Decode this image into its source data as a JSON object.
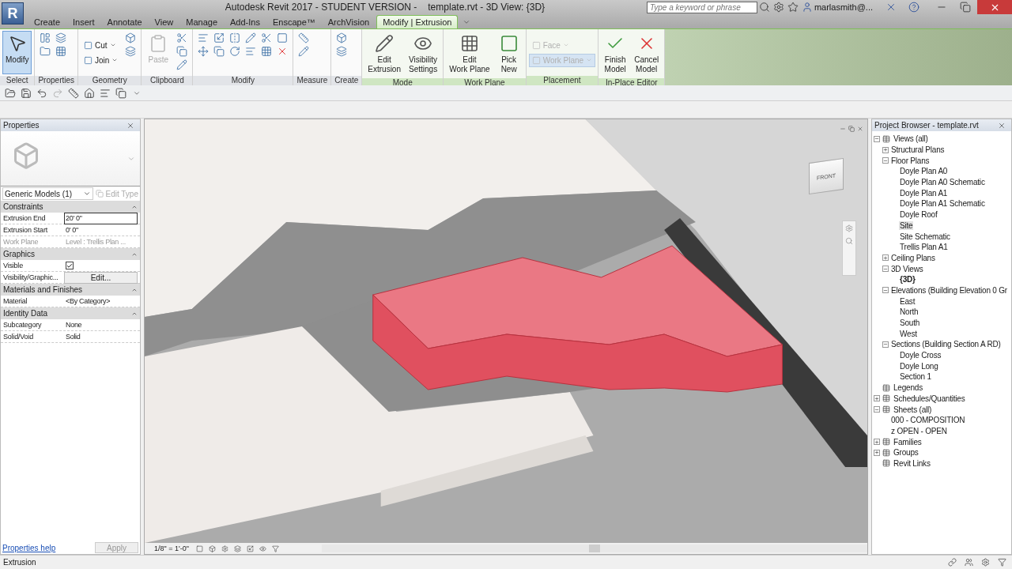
{
  "app_button": "R",
  "window": {
    "app_title": "Autodesk Revit 2017 - STUDENT VERSION -",
    "doc_title": "template.rvt - 3D View: {3D}"
  },
  "search": {
    "placeholder": "Type a keyword or phrase"
  },
  "user": "marlasmith@...",
  "tabs": [
    {
      "label": "Create",
      "selected": false
    },
    {
      "label": "Insert",
      "selected": false
    },
    {
      "label": "Annotate",
      "selected": false
    },
    {
      "label": "View",
      "selected": false
    },
    {
      "label": "Manage",
      "selected": false
    },
    {
      "label": "Add-Ins",
      "selected": false
    },
    {
      "label": "Enscape™",
      "selected": false
    },
    {
      "label": "ArchVision",
      "selected": false
    },
    {
      "label": "Modify | Extrusion",
      "selected": true
    }
  ],
  "ribbon": {
    "panels": [
      {
        "kind": "select",
        "label": "Select",
        "contextual": false,
        "buttons": [
          {
            "lines": [
              "Modify"
            ],
            "kind": "large",
            "disabled": false,
            "selected": true
          }
        ]
      },
      {
        "kind": "properties",
        "label": "Properties",
        "contextual": false
      },
      {
        "kind": "geometry",
        "label": "Geometry",
        "contextual": false,
        "buttons": [
          {
            "lines": [
              "Cut"
            ],
            "kind": "small",
            "disabled": false,
            "selected": false
          },
          {
            "lines": [
              "Join"
            ],
            "kind": "small",
            "disabled": false,
            "selected": false
          }
        ]
      },
      {
        "kind": "clipboard",
        "label": "Clipboard",
        "contextual": false,
        "buttons": [
          {
            "lines": [
              "Paste"
            ],
            "kind": "large",
            "disabled": true,
            "selected": false
          }
        ]
      },
      {
        "kind": "modify",
        "label": "Modify",
        "contextual": false
      },
      {
        "kind": "measure",
        "label": "Measure",
        "contextual": false
      },
      {
        "kind": "create",
        "label": "Create",
        "contextual": false
      },
      {
        "kind": "mode",
        "label": "Mode",
        "contextual": true,
        "buttons": [
          {
            "lines": [
              "Edit",
              "Extrusion"
            ],
            "kind": "large",
            "disabled": false,
            "selected": false
          },
          {
            "lines": [
              "Visibility",
              "Settings"
            ],
            "kind": "large",
            "disabled": false,
            "selected": false
          }
        ]
      },
      {
        "kind": "workplane",
        "label": "Work Plane",
        "contextual": true,
        "buttons": [
          {
            "lines": [
              "Edit",
              "Work Plane"
            ],
            "kind": "large",
            "disabled": false,
            "selected": false
          },
          {
            "lines": [
              "Pick",
              "New"
            ],
            "kind": "large",
            "disabled": false,
            "selected": false
          }
        ]
      },
      {
        "kind": "placement",
        "label": "Placement",
        "contextual": true,
        "buttons": [
          {
            "lines": [
              "Face"
            ],
            "kind": "small",
            "disabled": true,
            "selected": false
          },
          {
            "lines": [
              "Work Plane"
            ],
            "kind": "small",
            "disabled": true,
            "selected": true
          }
        ]
      },
      {
        "kind": "inplace",
        "label": "In-Place Editor",
        "contextual": true,
        "buttons": [
          {
            "lines": [
              "Finish",
              "Model"
            ],
            "kind": "large",
            "disabled": false,
            "selected": false
          },
          {
            "lines": [
              "Cancel",
              "Model"
            ],
            "kind": "large",
            "disabled": false,
            "selected": false
          }
        ]
      }
    ]
  },
  "properties": {
    "title": "Properties",
    "type_selector": "Generic Models (1)",
    "edit_type": {
      "label": "Edit Type",
      "disabled": true
    },
    "groups": [
      {
        "label": "Constraints",
        "rows": [
          {
            "name": "Extrusion End",
            "kind": "input",
            "value": "20'  0\"",
            "disabled": false
          },
          {
            "name": "Extrusion Start",
            "kind": "text",
            "value": "0'  0\"",
            "disabled": false
          },
          {
            "name": "Work Plane",
            "kind": "text",
            "value": "Level : Trellis Plan ...",
            "disabled": true
          }
        ]
      },
      {
        "label": "Graphics",
        "rows": [
          {
            "name": "Visible",
            "kind": "checkbox",
            "checked": true,
            "disabled": false
          },
          {
            "name": "Visibility/Graphic...",
            "kind": "button",
            "value": "Edit...",
            "disabled": false
          }
        ]
      },
      {
        "label": "Materials and Finishes",
        "rows": [
          {
            "name": "Material",
            "kind": "text",
            "value": "<By Category>",
            "disabled": false
          }
        ]
      },
      {
        "label": "Identity Data",
        "rows": [
          {
            "name": "Subcategory",
            "kind": "text",
            "value": "None",
            "disabled": false
          },
          {
            "name": "Solid/Void",
            "kind": "text",
            "value": "Solid",
            "disabled": false
          }
        ]
      }
    ],
    "help_link": "Properties help",
    "apply": {
      "label": "Apply",
      "disabled": true
    }
  },
  "view": {
    "cube_face": "FRONT",
    "scale": "1/8\" = 1'-0\""
  },
  "browser": {
    "title": "Project Browser - template.rvt",
    "tree": [
      {
        "label": "Views (all)",
        "expanded": true,
        "selected": false,
        "current": false,
        "children": [
          {
            "label": "Structural Plans",
            "expanded": false,
            "selected": false,
            "current": false
          },
          {
            "label": "Floor Plans",
            "expanded": true,
            "selected": false,
            "current": false,
            "children": [
              {
                "label": "Doyle Plan A0",
                "selected": false,
                "current": false
              },
              {
                "label": "Doyle Plan A0 Schematic",
                "selected": false,
                "current": false
              },
              {
                "label": "Doyle Plan A1",
                "selected": false,
                "current": false
              },
              {
                "label": "Doyle Plan A1 Schematic",
                "selected": false,
                "current": false
              },
              {
                "label": "Doyle Roof",
                "selected": false,
                "current": false
              },
              {
                "label": "Site",
                "selected": true,
                "current": false
              },
              {
                "label": "Site Schematic",
                "selected": false,
                "current": false
              },
              {
                "label": "Trellis Plan A1",
                "selected": false,
                "current": false
              }
            ]
          },
          {
            "label": "Ceiling Plans",
            "expanded": false,
            "selected": false,
            "current": false
          },
          {
            "label": "3D Views",
            "expanded": true,
            "selected": false,
            "current": false,
            "children": [
              {
                "label": "{3D}",
                "selected": false,
                "current": true
              }
            ]
          },
          {
            "label": "Elevations (Building Elevation 0 Gr",
            "expanded": true,
            "selected": false,
            "current": false,
            "children": [
              {
                "label": "East",
                "selected": false,
                "current": false
              },
              {
                "label": "North",
                "selected": false,
                "current": false
              },
              {
                "label": "South",
                "selected": false,
                "current": false
              },
              {
                "label": "West",
                "selected": false,
                "current": false
              }
            ]
          },
          {
            "label": "Sections (Building Section A RD)",
            "expanded": true,
            "selected": false,
            "current": false,
            "children": [
              {
                "label": "Doyle Cross",
                "selected": false,
                "current": false
              },
              {
                "label": "Doyle Long",
                "selected": false,
                "current": false
              },
              {
                "label": "Section 1",
                "selected": false,
                "current": false
              }
            ]
          }
        ]
      },
      {
        "label": "Legends",
        "selected": false,
        "current": false
      },
      {
        "label": "Schedules/Quantities",
        "expanded": false,
        "selected": false,
        "current": false
      },
      {
        "label": "Sheets (all)",
        "expanded": true,
        "selected": false,
        "current": false,
        "children": [
          {
            "label": "000 - COMPOSITION",
            "selected": false,
            "current": false
          },
          {
            "label": "z OPEN - OPEN",
            "selected": false,
            "current": false
          }
        ]
      },
      {
        "label": "Families",
        "expanded": false,
        "selected": false,
        "current": false
      },
      {
        "label": "Groups",
        "expanded": false,
        "selected": false,
        "current": false
      },
      {
        "label": "Revit Links",
        "selected": false,
        "current": false
      }
    ]
  },
  "status_bar": {
    "text": "Extrusion"
  }
}
